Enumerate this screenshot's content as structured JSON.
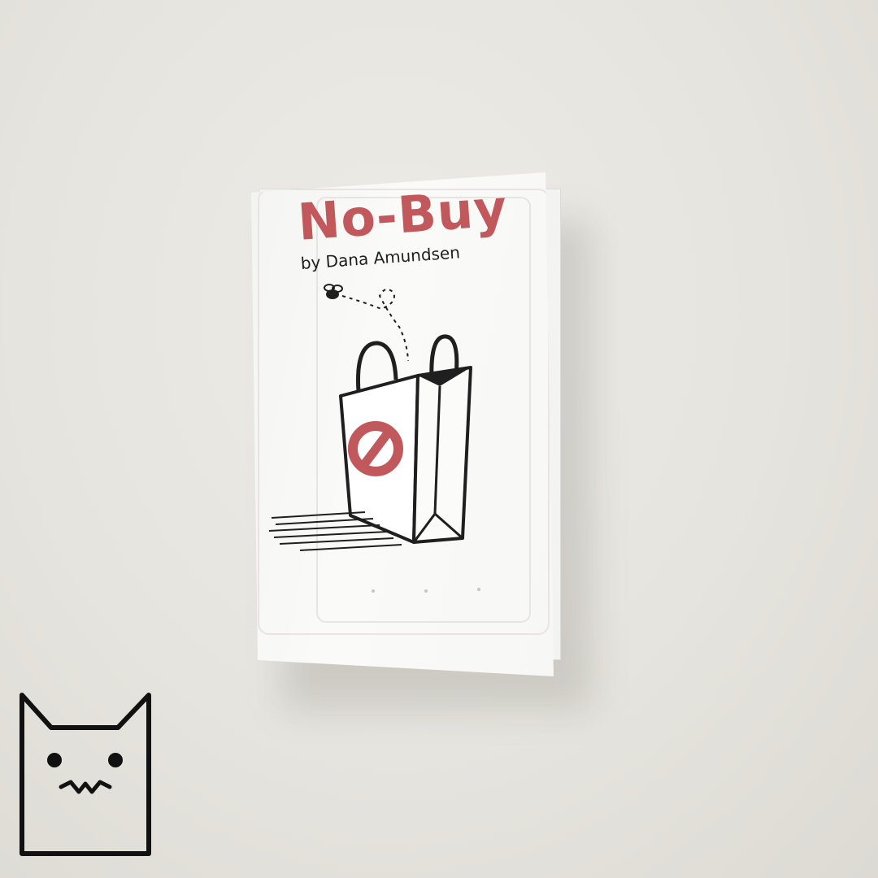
{
  "zine": {
    "title": "No-Buy",
    "byline": "by Dana Amundsen"
  },
  "colors": {
    "background": "#e6e4de",
    "cover": "#f7f7f5",
    "title_red": "#c0585c",
    "ink": "#1f1f1f"
  },
  "icons": {
    "bag": "shopping-bag-icon",
    "no_sign": "prohibition-sign-icon",
    "fly": "fly-icon",
    "cat": "cat-face-icon"
  }
}
